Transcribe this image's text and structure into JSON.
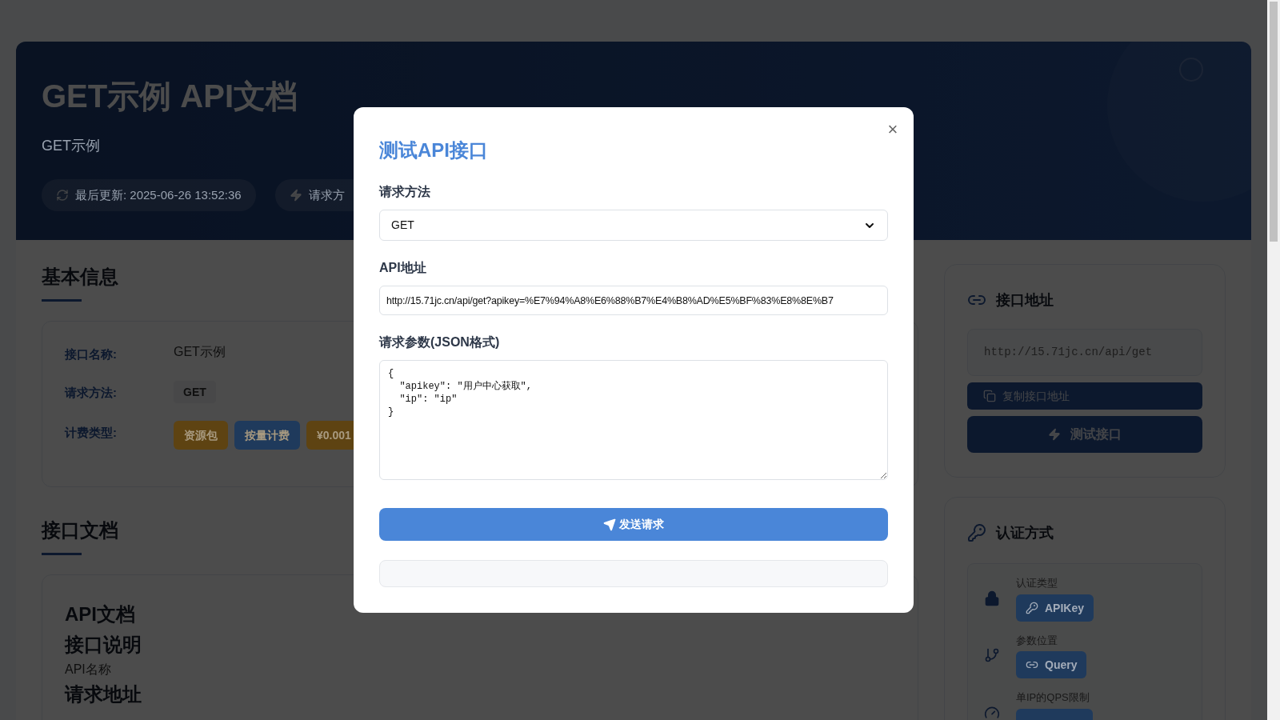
{
  "header": {
    "title": "GET示例 API文档",
    "subtitle": "GET示例",
    "pills": [
      {
        "kind": "updated",
        "text": "最后更新: 2025-06-26 13:52:36"
      },
      {
        "kind": "method",
        "text": "请求方"
      }
    ]
  },
  "basic_info": {
    "heading": "基本信息",
    "rows": [
      {
        "label": "接口名称:",
        "kind": "text",
        "value": "GET示例"
      },
      {
        "label": "请求方法:",
        "kind": "method",
        "value": "GET"
      },
      {
        "label": "计费类型:",
        "kind": "tags",
        "tags": [
          {
            "text": "资源包",
            "color": "#5e4312"
          },
          {
            "text": "按量计费",
            "color": "#1f3a5c"
          },
          {
            "text": "¥0.001",
            "color": "#5e4312"
          }
        ]
      }
    ]
  },
  "docs": {
    "heading": "接口文档",
    "lines": [
      {
        "kind": "h1",
        "text": "API文档"
      },
      {
        "kind": "h2",
        "text": "接口说明"
      },
      {
        "kind": "p",
        "text": "API名称"
      },
      {
        "kind": "h2",
        "text": "请求地址"
      }
    ]
  },
  "endpoint_card": {
    "heading": "接口地址",
    "url": "http://15.71jc.cn/api/get",
    "copy_button": "复制接口地址",
    "test_button": "测试接口"
  },
  "auth_card": {
    "heading": "认证方式",
    "items": [
      {
        "kind": "lock",
        "label": "认证类型",
        "badge": "APIKey"
      },
      {
        "kind": "branch",
        "label": "参数位置",
        "badge": "Query"
      },
      {
        "kind": "gauge",
        "label": "单IP的QPS限制"
      }
    ]
  },
  "modal": {
    "title": "测试API接口",
    "close": "×",
    "method_label": "请求方法",
    "method_value": "GET",
    "url_label": "API地址",
    "url_value": "http://15.71jc.cn/api/get?apikey=%E7%94%A8%E6%88%B7%E4%B8%AD%E5%BF%83%E8%8E%B7",
    "params_label": "请求参数(JSON格式)",
    "params_value": "{\n  \"apikey\": \"用户中心获取\",\n  \"ip\": \"ip\"\n}",
    "send_button": "发送请求"
  }
}
